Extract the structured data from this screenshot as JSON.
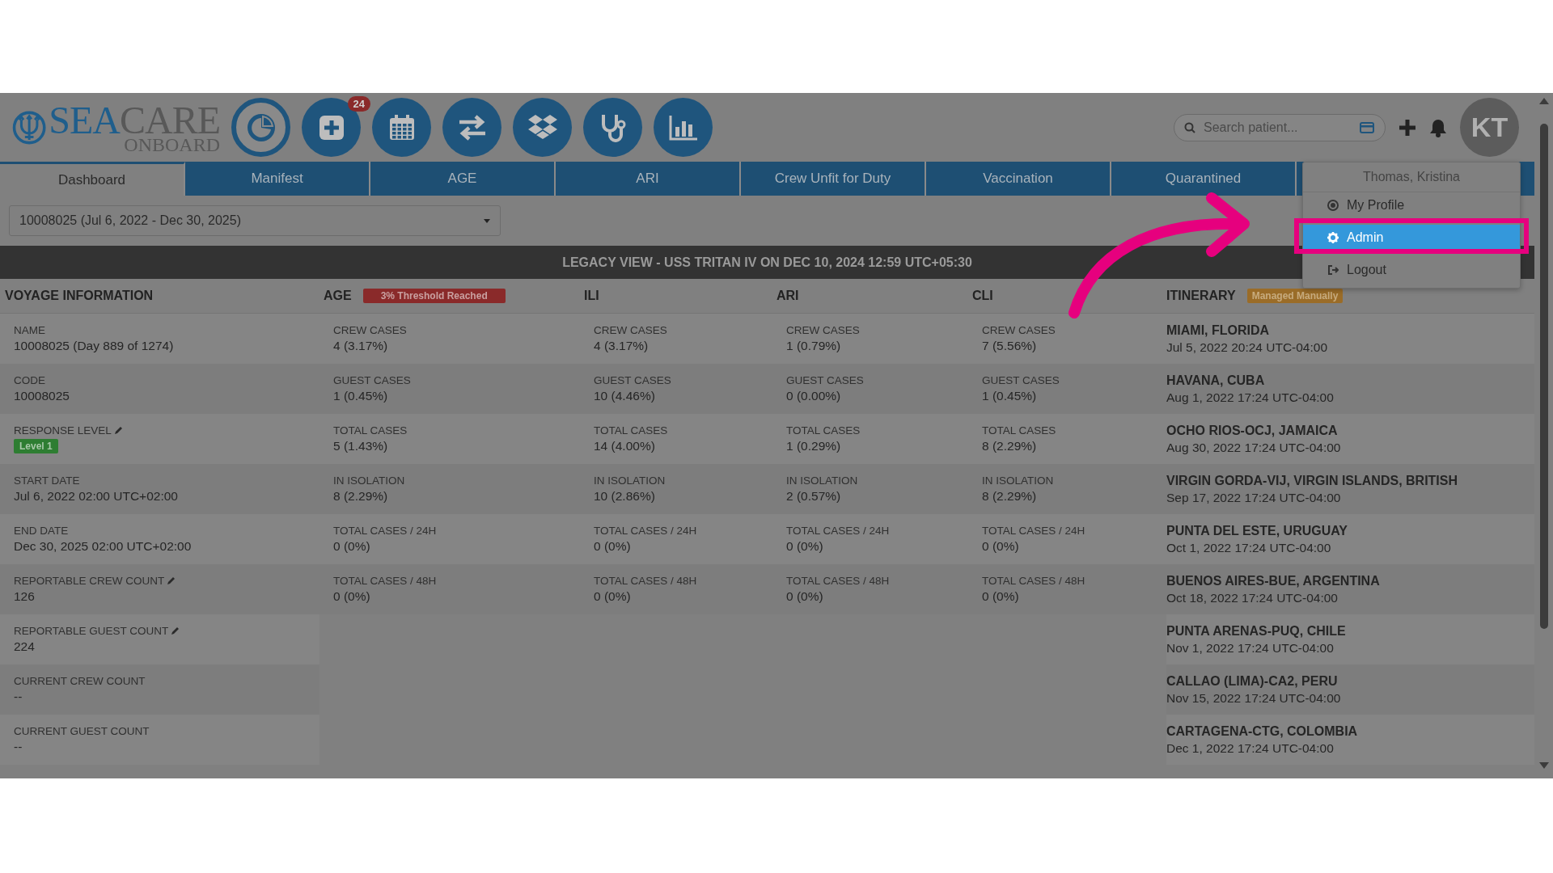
{
  "logo": {
    "brand_primary": "SEA",
    "brand_secondary": "CARE",
    "tagline": "ONBOARD"
  },
  "toolbar": [
    {
      "kind": "dashboard"
    },
    {
      "kind": "add",
      "badge": "24"
    },
    {
      "kind": "calendar"
    },
    {
      "kind": "transfer"
    },
    {
      "kind": "boxes"
    },
    {
      "kind": "stethoscope"
    },
    {
      "kind": "chart"
    }
  ],
  "search": {
    "placeholder": "Search patient..."
  },
  "avatar": {
    "initials": "KT"
  },
  "tabs": [
    {
      "label": "Dashboard",
      "selected": true
    },
    {
      "label": "Manifest",
      "selected": false
    },
    {
      "label": "AGE",
      "selected": false
    },
    {
      "label": "ARI",
      "selected": false
    },
    {
      "label": "Crew Unfit for Duty",
      "selected": false
    },
    {
      "label": "Vaccination",
      "selected": false
    },
    {
      "label": "Quarantined",
      "selected": false
    }
  ],
  "voyage_select": {
    "value": "10008025 (Jul 6, 2022 - Dec 30, 2025)"
  },
  "banner": "LEGACY VIEW - USS TRITAN IV ON DEC 10, 2024 12:59 UTC+05:30",
  "voyage_info": {
    "title": "VOYAGE INFORMATION",
    "fields": [
      {
        "label": "NAME",
        "value": "10008025 (Day 889 of 1274)",
        "kind": "text",
        "editable": false
      },
      {
        "label": "CODE",
        "value": "10008025",
        "kind": "text",
        "editable": false
      },
      {
        "label": "RESPONSE LEVEL",
        "value": "Level 1",
        "kind": "badge",
        "editable": true
      },
      {
        "label": "START DATE",
        "value": "Jul 6, 2022 02:00 UTC+02:00",
        "kind": "text",
        "editable": false
      },
      {
        "label": "END DATE",
        "value": "Dec 30, 2025 02:00 UTC+02:00",
        "kind": "text",
        "editable": false
      },
      {
        "label": "REPORTABLE CREW COUNT",
        "value": "126",
        "kind": "text",
        "editable": true
      },
      {
        "label": "REPORTABLE GUEST COUNT",
        "value": "224",
        "kind": "text",
        "editable": true
      },
      {
        "label": "CURRENT CREW COUNT",
        "value": "--",
        "kind": "text",
        "editable": false
      },
      {
        "label": "CURRENT GUEST COUNT",
        "value": "--",
        "kind": "text",
        "editable": false
      }
    ]
  },
  "stats": [
    {
      "title": "AGE",
      "alert": "3% Threshold Reached",
      "rows": [
        {
          "label": "CREW CASES",
          "value": "4 (3.17%)"
        },
        {
          "label": "GUEST CASES",
          "value": "1 (0.45%)"
        },
        {
          "label": "TOTAL CASES",
          "value": "5 (1.43%)"
        },
        {
          "label": "IN ISOLATION",
          "value": "8 (2.29%)"
        },
        {
          "label": "TOTAL CASES / 24H",
          "value": "0 (0%)"
        },
        {
          "label": "TOTAL CASES / 48H",
          "value": "0 (0%)"
        }
      ]
    },
    {
      "title": "ILI",
      "rows": [
        {
          "label": "CREW CASES",
          "value": "4 (3.17%)"
        },
        {
          "label": "GUEST CASES",
          "value": "10 (4.46%)"
        },
        {
          "label": "TOTAL CASES",
          "value": "14 (4.00%)"
        },
        {
          "label": "IN ISOLATION",
          "value": "10 (2.86%)"
        },
        {
          "label": "TOTAL CASES / 24H",
          "value": "0 (0%)"
        },
        {
          "label": "TOTAL CASES / 48H",
          "value": "0 (0%)"
        }
      ]
    },
    {
      "title": "ARI",
      "rows": [
        {
          "label": "CREW CASES",
          "value": "1 (0.79%)"
        },
        {
          "label": "GUEST CASES",
          "value": "0 (0.00%)"
        },
        {
          "label": "TOTAL CASES",
          "value": "1 (0.29%)"
        },
        {
          "label": "IN ISOLATION",
          "value": "2 (0.57%)"
        },
        {
          "label": "TOTAL CASES / 24H",
          "value": "0 (0%)"
        },
        {
          "label": "TOTAL CASES / 48H",
          "value": "0 (0%)"
        }
      ]
    },
    {
      "title": "CLI",
      "rows": [
        {
          "label": "CREW CASES",
          "value": "7 (5.56%)"
        },
        {
          "label": "GUEST CASES",
          "value": "1 (0.45%)"
        },
        {
          "label": "TOTAL CASES",
          "value": "8 (2.29%)"
        },
        {
          "label": "IN ISOLATION",
          "value": "8 (2.29%)"
        },
        {
          "label": "TOTAL CASES / 24H",
          "value": "0 (0%)"
        },
        {
          "label": "TOTAL CASES / 48H",
          "value": "0 (0%)"
        }
      ]
    }
  ],
  "itinerary": {
    "title": "ITINERARY",
    "tag": "Managed Manually",
    "stops": [
      {
        "place": "MIAMI, FLORIDA",
        "time": "Jul 5, 2022 20:24 UTC-04:00"
      },
      {
        "place": "HAVANA, CUBA",
        "time": "Aug 1, 2022 17:24 UTC-04:00"
      },
      {
        "place": "OCHO RIOS-OCJ, JAMAICA",
        "time": "Aug 30, 2022 17:24 UTC-04:00"
      },
      {
        "place": "VIRGIN GORDA-VIJ, VIRGIN ISLANDS, BRITISH",
        "time": "Sep 17, 2022 17:24 UTC-04:00"
      },
      {
        "place": "PUNTA DEL ESTE, URUGUAY",
        "time": "Oct 1, 2022 17:24 UTC-04:00"
      },
      {
        "place": "BUENOS AIRES-BUE, ARGENTINA",
        "time": "Oct 18, 2022 17:24 UTC-04:00"
      },
      {
        "place": "PUNTA ARENAS-PUQ, CHILE",
        "time": "Nov 1, 2022 17:24 UTC-04:00"
      },
      {
        "place": "CALLAO (LIMA)-CA2, PERU",
        "time": "Nov 15, 2022 17:24 UTC-04:00"
      },
      {
        "place": "CARTAGENA-CTG, COLOMBIA",
        "time": "Dec 1, 2022 17:24 UTC-04:00"
      }
    ]
  },
  "user_menu": {
    "name": "Thomas, Kristina",
    "items": [
      {
        "label": "My Profile",
        "kind": "profile",
        "selected": false
      },
      {
        "label": "Admin",
        "kind": "admin",
        "selected": true
      },
      {
        "label": "Logout",
        "kind": "logout",
        "selected": false
      }
    ]
  }
}
